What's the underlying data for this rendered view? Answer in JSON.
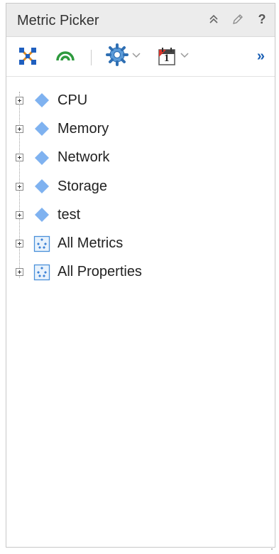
{
  "panel": {
    "title": "Metric Picker"
  },
  "header_icons": [
    "collapse-icon",
    "edit-icon",
    "help-icon"
  ],
  "header_labels": {
    "help": "?"
  },
  "toolbar": {
    "more_label": "»",
    "items": [
      "topology-icon",
      "signal-icon",
      "gear-icon",
      "calendar-icon"
    ],
    "calendar_day": "1"
  },
  "tree": {
    "nodes": [
      {
        "label": "CPU",
        "icon": "metric-group-icon"
      },
      {
        "label": "Memory",
        "icon": "metric-group-icon"
      },
      {
        "label": "Network",
        "icon": "metric-group-icon"
      },
      {
        "label": "Storage",
        "icon": "metric-group-icon"
      },
      {
        "label": "test",
        "icon": "metric-group-icon"
      },
      {
        "label": "All Metrics",
        "icon": "metrics-folder-icon"
      },
      {
        "label": "All Properties",
        "icon": "properties-folder-icon"
      }
    ]
  },
  "colors": {
    "diamond": "#7fb2f0",
    "accent_blue": "#1a5fb4",
    "signal_green": "#2e9a3e",
    "calendar_red": "#d9342b"
  }
}
